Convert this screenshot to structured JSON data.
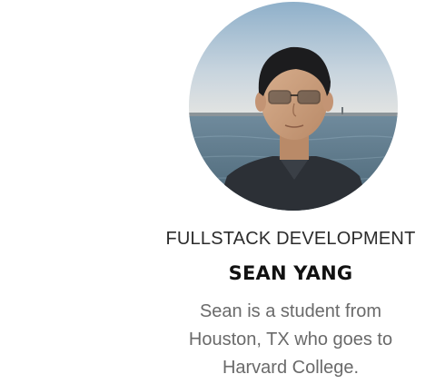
{
  "profile": {
    "role": "FULLSTACK DEVELOPMENT",
    "name": "SEAN YANG",
    "bio_lines": [
      "Sean is a student from",
      "Houston, TX who goes to",
      "Harvard College."
    ],
    "avatar_alt": "profile-photo"
  },
  "colors": {
    "role_text": "#2b2b2b",
    "name_text": "#111111",
    "bio_text": "#6a6a6a",
    "sky_top": "#9fb9cf",
    "sky_bottom": "#d9dde0",
    "sea": "#5f7b8f"
  }
}
